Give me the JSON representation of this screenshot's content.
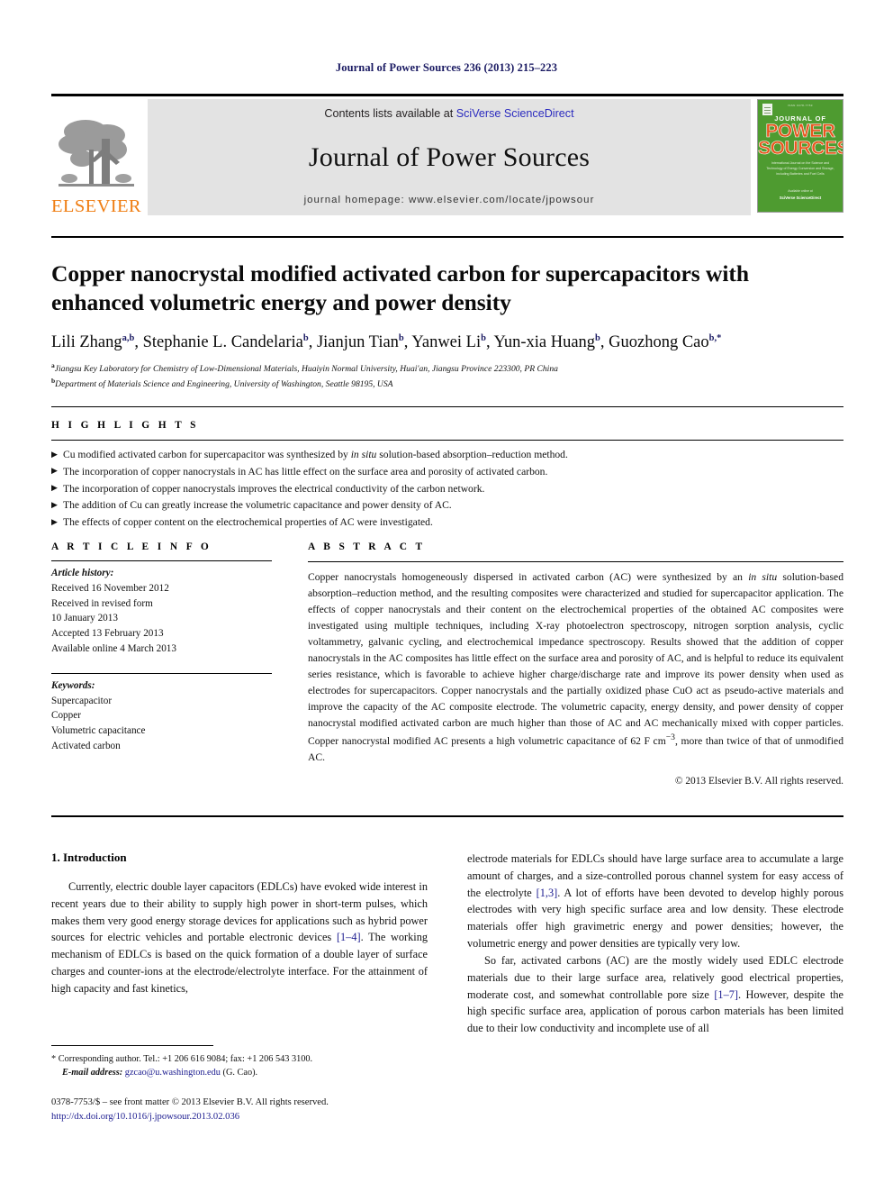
{
  "running_head": "Journal of Power Sources 236 (2013) 215–223",
  "masthead": {
    "contents_prefix": "Contents lists available at ",
    "sciencedirect": "SciVerse ScienceDirect",
    "journal_name": "Journal of Power Sources",
    "homepage": "journal homepage: www.elsevier.com/locate/jpowsour",
    "publisher_wordmark": "ELSEVIER",
    "publisher_color": "#ef7d12",
    "link_color": "#2b2bbf",
    "cover": {
      "top_caption": "ISSN 0378-7753",
      "line1": "JOURNAL OF",
      "line2": "POWER",
      "line3": "SOURCES",
      "subtitle": "International Journal on the Science and Technology of Energy Conversion and Storage, including Batteries and Fuel Cells",
      "footer1": "Available online at",
      "footer2": "SciVerse ScienceDirect",
      "bg_color": "#4e9b30",
      "title_color": "#e8551c"
    }
  },
  "article": {
    "title": "Copper nanocrystal modified activated carbon for supercapacitors with enhanced volumetric energy and power density",
    "authors": [
      {
        "name": "Lili Zhang",
        "sup": "a,b"
      },
      {
        "name": "Stephanie L. Candelaria",
        "sup": "b"
      },
      {
        "name": "Jianjun Tian",
        "sup": "b"
      },
      {
        "name": "Yanwei Li",
        "sup": "b"
      },
      {
        "name": "Yun-xia Huang",
        "sup": "b"
      },
      {
        "name": "Guozhong Cao",
        "sup": "b,*"
      }
    ],
    "affiliations": [
      {
        "sup": "a",
        "text": "Jiangsu Key Laboratory for Chemistry of Low-Dimensional Materials, Huaiyin Normal University, Huai'an, Jiangsu Province 223300, PR China"
      },
      {
        "sup": "b",
        "text": "Department of Materials Science and Engineering, University of Washington, Seattle 98195, USA"
      }
    ]
  },
  "highlights": {
    "label": "H I G H L I G H T S",
    "bullet": "▶",
    "items": [
      {
        "pre": "Cu modified activated carbon for supercapacitor was synthesized by ",
        "em": "in situ",
        "post": " solution-based absorption–reduction method."
      },
      {
        "pre": "The incorporation of copper nanocrystals in AC has little effect on the surface area and porosity of activated carbon.",
        "em": "",
        "post": ""
      },
      {
        "pre": "The incorporation of copper nanocrystals improves the electrical conductivity of the carbon network.",
        "em": "",
        "post": ""
      },
      {
        "pre": "The addition of Cu can greatly increase the volumetric capacitance and power density of AC.",
        "em": "",
        "post": ""
      },
      {
        "pre": "The effects of copper content on the electrochemical properties of AC were investigated.",
        "em": "",
        "post": ""
      }
    ]
  },
  "article_info": {
    "label": "A R T I C L E    I N F O",
    "history_head": "Article history:",
    "history_lines": [
      "Received 16 November 2012",
      "Received in revised form",
      "10 January 2013",
      "Accepted 13 February 2013",
      "Available online 4 March 2013"
    ],
    "keywords_head": "Keywords:",
    "keywords": [
      "Supercapacitor",
      "Copper",
      "Volumetric capacitance",
      "Activated carbon"
    ]
  },
  "abstract": {
    "label": "A B S T R A C T",
    "part1": "Copper nanocrystals homogeneously dispersed in activated carbon (AC) were synthesized by an ",
    "em1": "in situ",
    "part2": " solution-based absorption–reduction method, and the resulting composites were characterized and studied for supercapacitor application. The effects of copper nanocrystals and their content on the electrochemical properties of the obtained AC composites were investigated using multiple techniques, including X-ray photoelectron spectroscopy, nitrogen sorption analysis, cyclic voltammetry, galvanic cycling, and electrochemical impedance spectroscopy. Results showed that the addition of copper nanocrystals in the AC composites has little effect on the surface area and porosity of AC, and is helpful to reduce its equivalent series resistance, which is favorable to achieve higher charge/discharge rate and improve its power density when used as electrodes for supercapacitors. Copper nanocrystals and the partially oxidized phase CuO act as pseudo-active materials and improve the capacity of the AC composite electrode. The volumetric capacity, energy density, and power density of copper nanocrystal modified activated carbon are much higher than those of AC and AC mechanically mixed with copper particles. Copper nanocrystal modified AC presents a high volumetric capacitance of 62 F cm",
    "sup": "−3",
    "part3": ", more than twice of that of unmodified AC.",
    "copyright": "© 2013 Elsevier B.V. All rights reserved."
  },
  "body": {
    "section_number_title": "1.  Introduction",
    "left_paragraph_1_a": "Currently, electric double layer capacitors (EDLCs) have evoked wide interest in recent years due to their ability to supply high power in short-term pulses, which makes them very good energy storage devices for applications such as hybrid power sources for electric vehicles and portable electronic devices ",
    "left_ref_1": "[1–4]",
    "left_paragraph_1_b": ". The working mechanism of EDLCs is based on the quick formation of a double layer of surface charges and counter-ions at the electrode/electrolyte interface. For the attainment of high capacity and fast kinetics,",
    "right_paragraph_1_a": "electrode materials for EDLCs should have large surface area to accumulate a large amount of charges, and a size-controlled porous channel system for easy access of the electrolyte ",
    "right_ref_1": "[1,3]",
    "right_paragraph_1_b": ". A lot of efforts have been devoted to develop highly porous electrodes with very high specific surface area and low density. These electrode materials offer high gravimetric energy and power densities; however, the volumetric energy and power densities are typically very low.",
    "right_paragraph_2_a": "So far, activated carbons (AC) are the mostly widely used EDLC electrode materials due to their large surface area, relatively good electrical properties, moderate cost, and somewhat controllable pore size ",
    "right_ref_2": "[1–7]",
    "right_paragraph_2_b": ". However, despite the high specific surface area, application of porous carbon materials has been limited due to their low conductivity and incomplete use of all"
  },
  "footer": {
    "corresponding": "* Corresponding author. Tel.: +1 206 616 9084; fax: +1 206 543 3100.",
    "email_label": "E-mail address:",
    "email": "gzcao@u.washington.edu",
    "email_owner": "(G. Cao).",
    "issn_line": "0378-7753/$ – see front matter © 2013 Elsevier B.V. All rights reserved.",
    "doi": "http://dx.doi.org/10.1016/j.jpowsour.2013.02.036"
  }
}
